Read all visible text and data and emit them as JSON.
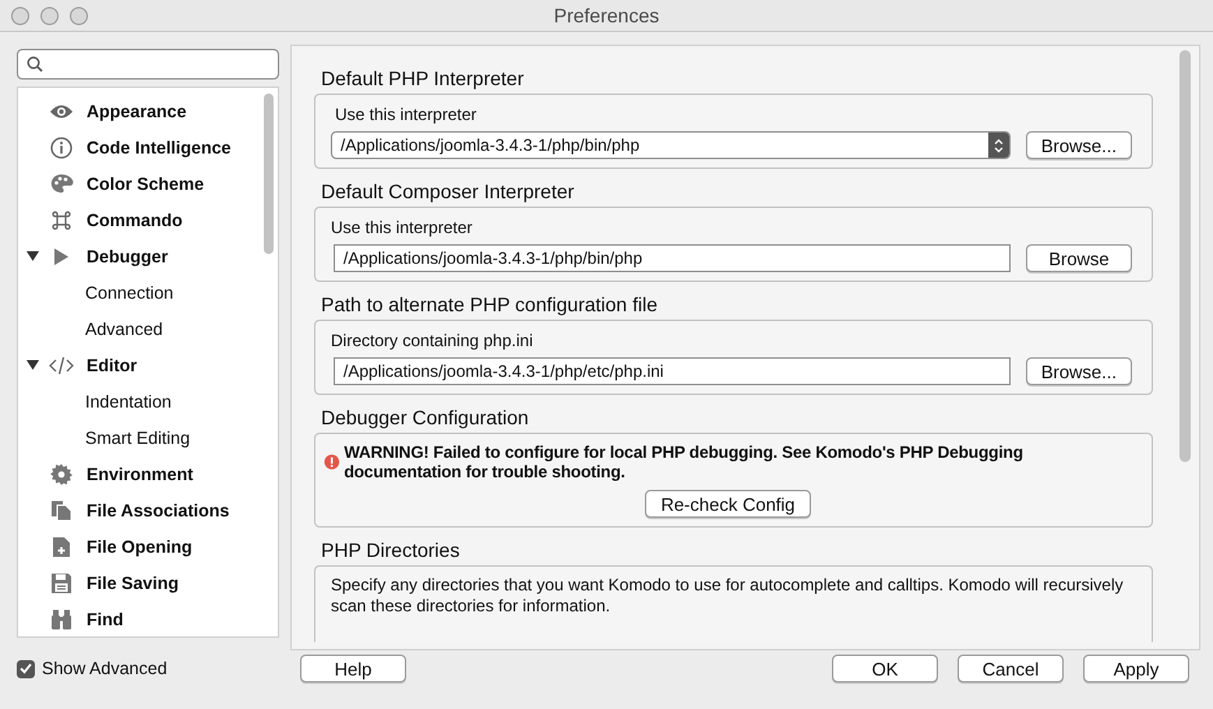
{
  "window": {
    "title": "Preferences"
  },
  "sidebar": {
    "items": [
      {
        "label": "Appearance"
      },
      {
        "label": "Code Intelligence"
      },
      {
        "label": "Color Scheme"
      },
      {
        "label": "Commando"
      },
      {
        "label": "Debugger",
        "expanded": true,
        "children": [
          {
            "label": "Connection"
          },
          {
            "label": "Advanced"
          }
        ]
      },
      {
        "label": "Editor",
        "expanded": true,
        "children": [
          {
            "label": "Indentation"
          },
          {
            "label": "Smart Editing"
          }
        ]
      },
      {
        "label": "Environment"
      },
      {
        "label": "File Associations"
      },
      {
        "label": "File Opening"
      },
      {
        "label": "File Saving"
      },
      {
        "label": "Find"
      }
    ]
  },
  "sections": [
    {
      "kind": "select",
      "title": "Default PHP Interpreter",
      "label": "Use this interpreter",
      "value": "/Applications/joomla-3.4.3-1/php/bin/php",
      "button": "Browse..."
    },
    {
      "kind": "text",
      "title": "Default Composer Interpreter",
      "label": "Use this interpreter",
      "value": "/Applications/joomla-3.4.3-1/php/bin/php",
      "button": "Browse"
    },
    {
      "kind": "text",
      "title": "Path to alternate PHP configuration file",
      "label": "Directory containing php.ini",
      "value": "/Applications/joomla-3.4.3-1/php/etc/php.ini",
      "button": "Browse..."
    },
    {
      "kind": "warning",
      "title": "Debugger Configuration",
      "message": "WARNING! Failed to configure for local PHP debugging. See Komodo's PHP Debugging documentation for trouble shooting.",
      "button": "Re-check Config"
    },
    {
      "kind": "note",
      "title": "PHP Directories",
      "message": "Specify any directories that you want Komodo to use for autocomplete and calltips. Komodo will recursively scan these directories for information."
    }
  ],
  "footer": {
    "show_advanced": {
      "label": "Show Advanced",
      "checked": true
    },
    "help": "Help",
    "buttons": [
      "OK",
      "Cancel",
      "Apply"
    ]
  }
}
